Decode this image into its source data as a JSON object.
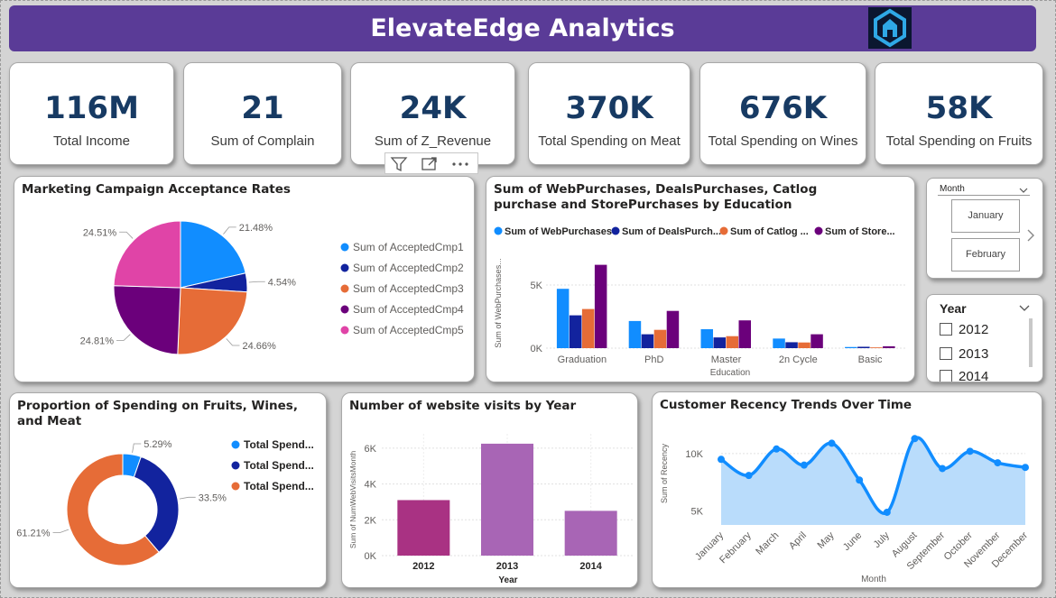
{
  "header": {
    "title": "ElevateEdge Analytics",
    "logo": "hexagon-house-logo"
  },
  "kpis": [
    {
      "value": "116M",
      "label": "Total Income"
    },
    {
      "value": "21",
      "label": "Sum of Complain"
    },
    {
      "value": "24K",
      "label": "Sum of Z_Revenue"
    },
    {
      "value": "370K",
      "label": "Total Spending on Meat"
    },
    {
      "value": "676K",
      "label": "Total Spending on Wines"
    },
    {
      "value": "58K",
      "label": "Total Spending on Fruits"
    }
  ],
  "toolbar": {
    "icons": [
      "filter-icon",
      "focus-mode-icon",
      "more-options-icon"
    ]
  },
  "slicers": {
    "month": {
      "header": "Month",
      "options": [
        "January",
        "February"
      ]
    },
    "year": {
      "header": "Year",
      "options": [
        "2012",
        "2013",
        "2014"
      ]
    }
  },
  "colors": {
    "banner": "#5a3b97",
    "kpi_value": "#173a63"
  },
  "chart_data": [
    {
      "type": "pie",
      "title": "Marketing Campaign Acceptance Rates",
      "labels": [
        "Sum of AcceptedCmp1",
        "Sum of AcceptedCmp2",
        "Sum of AcceptedCmp3",
        "Sum of AcceptedCmp4",
        "Sum of AcceptedCmp5"
      ],
      "values": [
        21.48,
        4.54,
        24.66,
        24.81,
        24.51
      ],
      "value_labels": [
        "21.48%",
        "4.54%",
        "24.66%",
        "24.81%",
        "24.51%"
      ],
      "colors": [
        "#118dff",
        "#12239e",
        "#e66c37",
        "#6b007b",
        "#e044a7"
      ],
      "legend": "right"
    },
    {
      "type": "bar",
      "title": "Sum of WebPurchases, DealsPurchases, Catlog purchase and StorePurchases by Education",
      "title_lines": [
        "Sum of WebPurchases, DealsPurchases, Catlog",
        "purchase and StorePurchases by Education"
      ],
      "xlabel": "Education",
      "ylabel": "Sum of WebPurchases...",
      "categories": [
        "Graduation",
        "PhD",
        "Master",
        "2n Cycle",
        "Basic"
      ],
      "yticks": [
        "0K",
        "5K"
      ],
      "ylim": [
        0,
        7000
      ],
      "legend": "top",
      "series": [
        {
          "name": "Sum of WebPurchases",
          "color": "#118dff",
          "values": [
            4700,
            2150,
            1500,
            760,
            90
          ]
        },
        {
          "name": "Sum of DealsPurch...",
          "color": "#12239e",
          "values": [
            2600,
            1100,
            850,
            470,
            110
          ]
        },
        {
          "name": "Sum of Catlog ...",
          "color": "#e66c37",
          "values": [
            3100,
            1450,
            950,
            450,
            60
          ]
        },
        {
          "name": "Sum of Store...",
          "color": "#6b007b",
          "values": [
            6600,
            2950,
            2200,
            1100,
            150
          ]
        }
      ]
    },
    {
      "type": "pie",
      "subtype": "donut",
      "title_lines": [
        "Proportion of Spending on Fruits, Wines,",
        "and Meat"
      ],
      "labels": [
        "Total Spend...",
        "Total Spend...",
        "Total Spend..."
      ],
      "values": [
        5.29,
        33.5,
        61.21
      ],
      "value_labels": [
        "5.29%",
        "33.5%",
        "61.21%"
      ],
      "colors": [
        "#118dff",
        "#12239e",
        "#e66c37"
      ],
      "legend": "right"
    },
    {
      "type": "bar",
      "title": "Number of website visits by Year",
      "xlabel": "Year",
      "ylabel": "Sum of NumWebVisitsMonth",
      "categories": [
        "2012",
        "2013",
        "2014"
      ],
      "values": [
        3100,
        6250,
        2500
      ],
      "colors": [
        "#a93283",
        "#a865b5",
        "#a865b5"
      ],
      "yticks": [
        "0K",
        "2K",
        "4K",
        "6K"
      ],
      "ylim": [
        0,
        6800
      ],
      "grid": true
    },
    {
      "type": "area",
      "title": "Customer Recency Trends Over Time",
      "xlabel": "Month",
      "ylabel": "Sum of Recency",
      "categories": [
        "January",
        "February",
        "March",
        "April",
        "May",
        "June",
        "July",
        "August",
        "September",
        "October",
        "November",
        "December"
      ],
      "values": [
        9500,
        8100,
        10400,
        9000,
        10900,
        7700,
        4900,
        11300,
        8700,
        10200,
        9200,
        8800
      ],
      "yticks": [
        "5K",
        "10K"
      ],
      "ylim": [
        3800,
        12500
      ],
      "color": "#118dff",
      "fill": "#b9dcfb",
      "grid": true
    }
  ]
}
